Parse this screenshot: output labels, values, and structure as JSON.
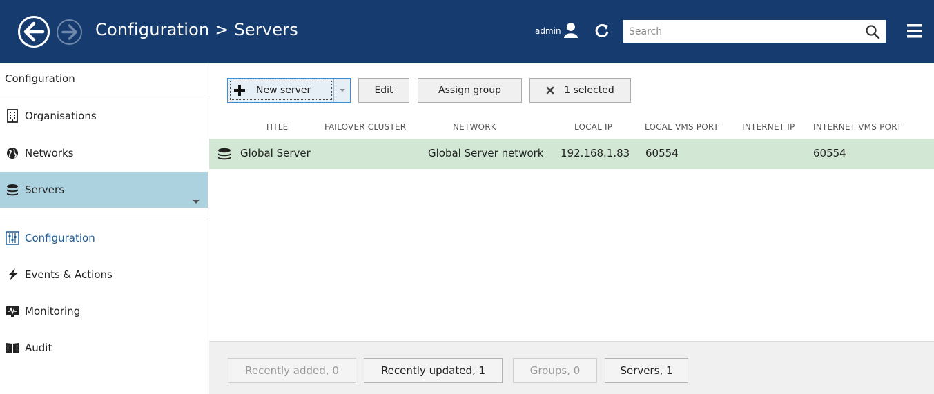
{
  "header": {
    "title": "Configuration > Servers",
    "user": "admin",
    "search_placeholder": "Search"
  },
  "sidebar": {
    "heading": "Configuration",
    "top_items": [
      {
        "label": "Organisations",
        "icon": "building-icon"
      },
      {
        "label": "Networks",
        "icon": "globe-icon"
      },
      {
        "label": "Servers",
        "icon": "server-stack-icon",
        "active": true
      }
    ],
    "bottom_items": [
      {
        "label": "Configuration",
        "icon": "sliders-icon",
        "active": true
      },
      {
        "label": "Events & Actions",
        "icon": "lightning-icon"
      },
      {
        "label": "Monitoring",
        "icon": "monitor-pulse-icon"
      },
      {
        "label": "Audit",
        "icon": "book-icon"
      }
    ]
  },
  "toolbar": {
    "new_server": "New server",
    "edit": "Edit",
    "assign_group": "Assign group",
    "selected": "1 selected"
  },
  "table": {
    "columns": [
      "TITLE",
      "FAILOVER CLUSTER",
      "NETWORK",
      "LOCAL IP",
      "LOCAL VMS PORT",
      "INTERNET IP",
      "INTERNET VMS PORT"
    ],
    "rows": [
      {
        "title": "Global Server",
        "failover_cluster": "",
        "network": "Global Server network",
        "local_ip": "192.168.1.83",
        "local_vms_port": "60554",
        "internet_ip": "",
        "internet_vms_port": "60554",
        "selected": true
      }
    ]
  },
  "footer": {
    "tabs": [
      {
        "label": "Recently added, 0",
        "enabled": false
      },
      {
        "label": "Recently updated, 1",
        "enabled": true
      },
      {
        "label": "Groups, 0",
        "enabled": false
      },
      {
        "label": "Servers, 1",
        "enabled": true
      }
    ]
  },
  "colors": {
    "header_bg": "#153b6f",
    "active_item_bg": "#acd2df",
    "selected_row_bg": "#d2e8d4",
    "active_sub_text": "#1f5b96"
  }
}
